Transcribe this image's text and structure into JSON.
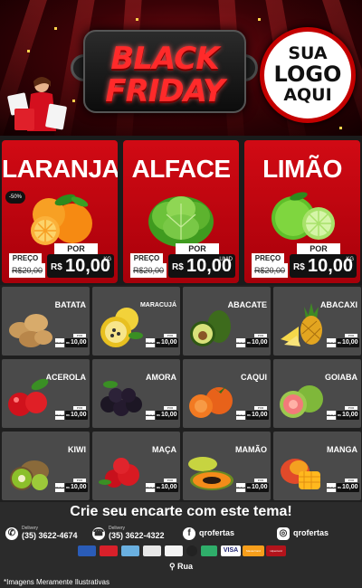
{
  "header": {
    "title_line1": "BLACK",
    "title_line2": "FRIDAY",
    "logo": [
      "SUA",
      "LOGO",
      "AQUI"
    ]
  },
  "featured": [
    {
      "name": "LARANJA",
      "badge": "-50%",
      "preco_label": "PREÇO",
      "por_label": "POR",
      "old_price": "R$20,00",
      "currency": "R$",
      "price": "10,00",
      "unit": "KG"
    },
    {
      "name": "ALFACE",
      "badge": "",
      "preco_label": "PREÇO",
      "por_label": "POR",
      "old_price": "R$20,00",
      "currency": "R$",
      "price": "10,00",
      "unit": "UNID"
    },
    {
      "name": "LIMÃO",
      "badge": "",
      "preco_label": "PREÇO",
      "por_label": "POR",
      "old_price": "R$20,00",
      "currency": "R$",
      "price": "10,00",
      "unit": "KG"
    }
  ],
  "grid": [
    {
      "name": "BATATA",
      "por": "POR",
      "old": "R$20,00",
      "currency": "R$",
      "price": "10,00"
    },
    {
      "name": "MARACUJÁ",
      "por": "POR",
      "old": "R$20,00",
      "currency": "R$",
      "price": "10,00"
    },
    {
      "name": "ABACATE",
      "por": "POR",
      "old": "R$20,00",
      "currency": "R$",
      "price": "10,00"
    },
    {
      "name": "ABACAXI",
      "por": "POR",
      "old": "R$20,00",
      "currency": "R$",
      "price": "10,00"
    },
    {
      "name": "ACEROLA",
      "por": "POR",
      "old": "R$20,00",
      "currency": "R$",
      "price": "10,00"
    },
    {
      "name": "AMORA",
      "por": "POR",
      "old": "R$20,00",
      "currency": "R$",
      "price": "10,00"
    },
    {
      "name": "CAQUI",
      "por": "POR",
      "old": "R$20,00",
      "currency": "R$",
      "price": "10,00"
    },
    {
      "name": "GOIABA",
      "por": "POR",
      "old": "R$20,00",
      "currency": "R$",
      "price": "10,00"
    },
    {
      "name": "KIWI",
      "por": "POR",
      "old": "R$20,00",
      "currency": "R$",
      "price": "10,00"
    },
    {
      "name": "MAÇA",
      "por": "POR",
      "old": "R$20,00",
      "currency": "R$",
      "price": "10,00"
    },
    {
      "name": "MAMÃO",
      "por": "POR",
      "old": "R$20,00",
      "currency": "R$",
      "price": "10,00"
    },
    {
      "name": "MANGA",
      "por": "POR",
      "old": "R$20,00",
      "currency": "R$",
      "price": "10,00"
    }
  ],
  "footer": {
    "cta": "Crie seu encarte com este tema!",
    "whatsapp_label": "Delivery",
    "whatsapp": "(35) 3622-4674",
    "phone_label": "Delivery",
    "phone": "(35) 3622-4322",
    "facebook": "qrofertas",
    "instagram": "qrofertas",
    "payments": [
      "VISA",
      "MasterCard",
      "Hipercard"
    ],
    "address": "Rua",
    "disclaimer": "*Imagens Meramente Ilustrativas"
  },
  "colors": {
    "brand_red": "#c40000",
    "dark_bg": "#1f1f1f",
    "card_grey": "#4a4a4a"
  },
  "icons": [
    "whatsapp-icon",
    "phone-icon",
    "facebook-icon",
    "instagram-icon",
    "location-pin-icon"
  ]
}
